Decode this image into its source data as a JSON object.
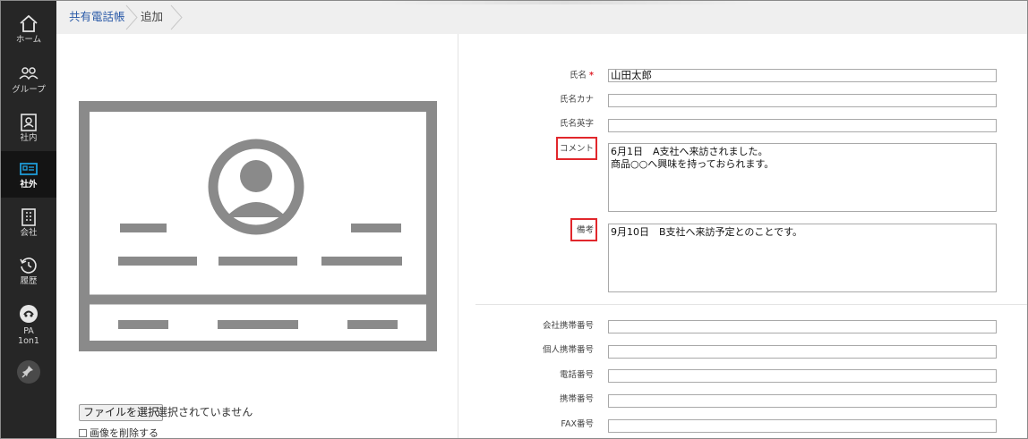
{
  "sidebar": {
    "items": [
      {
        "label": "ホーム",
        "icon": "home-icon"
      },
      {
        "label": "グループ",
        "icon": "group-icon"
      },
      {
        "label": "社内",
        "icon": "internal-contact-icon"
      },
      {
        "label": "社外",
        "icon": "external-card-icon"
      },
      {
        "label": "会社",
        "icon": "building-icon"
      },
      {
        "label": "履歴",
        "icon": "history-icon"
      },
      {
        "label_line1": "PA",
        "label_line2": "1on1",
        "icon": "pa-1on1-icon"
      }
    ],
    "pin_icon": "pin-icon",
    "active_item": "社外"
  },
  "breadcrumb": {
    "items": [
      "共有電話帳",
      "追加"
    ]
  },
  "left_pane": {
    "file_button": "ファイルを選択",
    "file_status": "選択されていません",
    "delete_image_label": "画像を削除する"
  },
  "form": {
    "name_label": "氏名",
    "name_required_mark": "*",
    "name_value": "山田太郎",
    "name_kana_label": "氏名カナ",
    "name_kana_value": "",
    "name_en_label": "氏名英字",
    "name_en_value": "",
    "comment_label": "コメント",
    "comment_value": "6月1日　A支社へ来訪されました。\n商品○○へ興味を持っておられます。",
    "remarks_label": "備考",
    "remarks_value": "9月10日　B支社へ来訪予定とのことです。",
    "company_mobile_label": "会社携帯番号",
    "personal_mobile_label": "個人携帯番号",
    "phone_label": "電話番号",
    "mobile_label": "携帯番号",
    "fax_label": "FAX番号"
  },
  "colors": {
    "sidebar_bg": "#262626",
    "link": "#2b5ba8",
    "required": "#e0232d",
    "highlight": "#e1272c",
    "illustration": "#8a8a8a"
  }
}
